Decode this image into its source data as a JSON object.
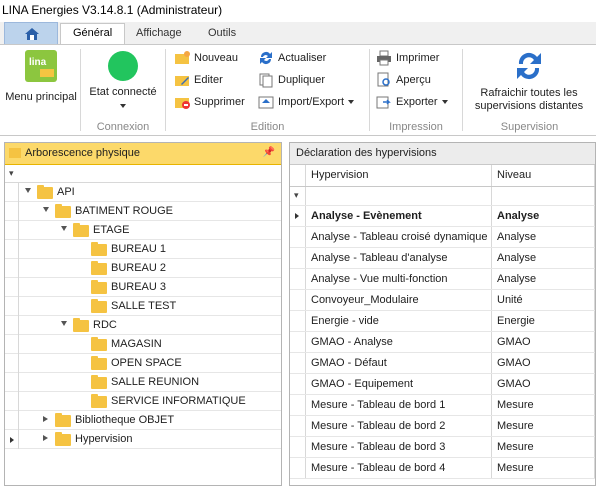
{
  "title": "LINA Energies  V3.14.8.1  (Administrateur)",
  "tabs": [
    "Général",
    "Affichage",
    "Outils"
  ],
  "ribbon": {
    "menu_principal": "Menu principal",
    "etat": "Etat connecté",
    "connexion": "Connexion",
    "nouveau": "Nouveau",
    "editer": "Editer",
    "supprimer": "Supprimer",
    "actualiser": "Actualiser",
    "dupliquer": "Dupliquer",
    "importexport": "Import/Export",
    "edition": "Edition",
    "imprimer": "Imprimer",
    "apercu": "Aperçu",
    "exporter": "Exporter",
    "impression": "Impression",
    "rafraichir1": "Rafraichir toutes les",
    "rafraichir2": "supervisions distantes",
    "supervision": "Supervision",
    "status_color": "#22c55e"
  },
  "left": {
    "title": "Arborescence physique",
    "tree": [
      {
        "label": "API",
        "level": 0,
        "exp": "open"
      },
      {
        "label": "BATIMENT ROUGE",
        "level": 1,
        "exp": "open"
      },
      {
        "label": "ETAGE",
        "level": 2,
        "exp": "open"
      },
      {
        "label": "BUREAU 1",
        "level": 3,
        "exp": ""
      },
      {
        "label": "BUREAU 2",
        "level": 3,
        "exp": ""
      },
      {
        "label": "BUREAU 3",
        "level": 3,
        "exp": ""
      },
      {
        "label": "SALLE TEST",
        "level": 3,
        "exp": ""
      },
      {
        "label": "RDC",
        "level": 2,
        "exp": "open"
      },
      {
        "label": "MAGASIN",
        "level": 3,
        "exp": ""
      },
      {
        "label": "OPEN SPACE",
        "level": 3,
        "exp": ""
      },
      {
        "label": "SALLE REUNION",
        "level": 3,
        "exp": ""
      },
      {
        "label": "SERVICE INFORMATIQUE",
        "level": 3,
        "exp": ""
      },
      {
        "label": "Bibliotheque OBJET",
        "level": 1,
        "exp": "closed"
      },
      {
        "label": "Hypervision",
        "level": 1,
        "exp": "closed"
      }
    ]
  },
  "right": {
    "title": "Déclaration des hypervisions",
    "columns": [
      "Hypervision",
      "Niveau"
    ],
    "rows": [
      [
        "Analyse - Evènement",
        "Analyse"
      ],
      [
        "Analyse - Tableau croisé dynamique",
        "Analyse"
      ],
      [
        "Analyse - Tableau d'analyse",
        "Analyse"
      ],
      [
        "Analyse - Vue multi-fonction",
        "Analyse"
      ],
      [
        "Convoyeur_Modulaire",
        "Unité"
      ],
      [
        "Energie - vide",
        "Energie"
      ],
      [
        "GMAO - Analyse",
        "GMAO"
      ],
      [
        "GMAO - Défaut",
        "GMAO"
      ],
      [
        "GMAO - Equipement",
        "GMAO"
      ],
      [
        "Mesure - Tableau de bord 1",
        "Mesure"
      ],
      [
        "Mesure - Tableau de bord 2",
        "Mesure"
      ],
      [
        "Mesure - Tableau de bord 3",
        "Mesure"
      ],
      [
        "Mesure - Tableau de bord 4",
        "Mesure"
      ]
    ]
  }
}
